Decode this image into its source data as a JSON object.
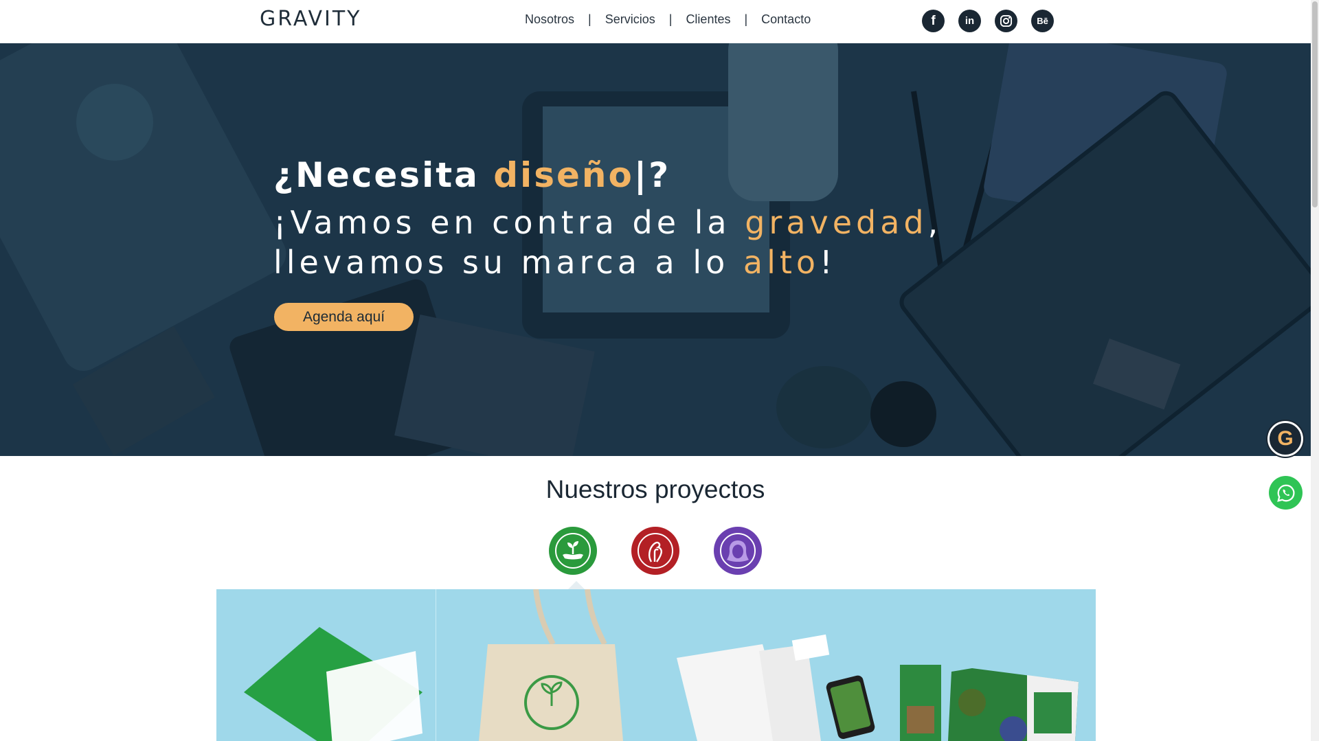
{
  "header": {
    "logo": "GRAVITY",
    "nav": [
      "Nosotros",
      "Servicios",
      "Clientes",
      "Contacto"
    ],
    "separator": "|",
    "socials": [
      {
        "icon": "facebook-icon",
        "label": "f"
      },
      {
        "icon": "linkedin-icon",
        "label": "in"
      },
      {
        "icon": "instagram-icon",
        "label": ""
      },
      {
        "icon": "behance-icon",
        "label": "Bē"
      }
    ]
  },
  "hero": {
    "title_start": "¿Necesita ",
    "title_accent": "diseño",
    "title_end": "|?",
    "line1_start": "¡Vamos en contra de la ",
    "line1_accent": "gravedad",
    "line1_end": ",",
    "line2_start": "llevamos su marca a lo ",
    "line2_accent": "alto",
    "line2_end": "!",
    "cta": "Agenda aquí"
  },
  "floating": {
    "gravity_badge": "G",
    "whatsapp": "whatsapp-icon"
  },
  "projects": {
    "title": "Nuestros proyectos",
    "icons": [
      "plant-hand-icon",
      "rooster-icon",
      "woman-silhouette-icon"
    ]
  },
  "colors": {
    "accent": "#f2b363",
    "dark": "#1a2733",
    "hero_bg": "#1c3548",
    "showcase_bg": "#9fd8ea",
    "whatsapp": "#2fc455"
  }
}
